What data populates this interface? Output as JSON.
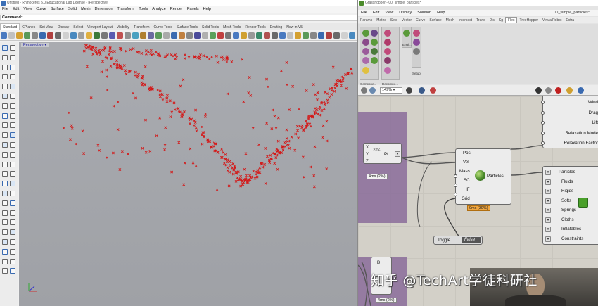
{
  "rhino": {
    "title": "Untitled - Rhinoceros 5.0 Educational Lab License - [Perspective]",
    "menu": [
      "File",
      "Edit",
      "View",
      "Curve",
      "Surface",
      "Solid",
      "Mesh",
      "Dimension",
      "Transform",
      "Tools",
      "Analyze",
      "Render",
      "Panels",
      "Help"
    ],
    "command_label": "Command:",
    "tabs": [
      "Standard",
      "CPlanes",
      "Set View",
      "Display",
      "Select",
      "Viewport Layout",
      "Visibility",
      "Transform",
      "Curve Tools",
      "Surface Tools",
      "Solid Tools",
      "Mesh Tools",
      "Render Tools",
      "Drafting",
      "New in V5"
    ],
    "active_tab": "Standard",
    "viewport_label": "Perspective"
  },
  "gh": {
    "title": "Grasshopper - 00_simple_particles*",
    "document": "00_simple_particles*",
    "menu": [
      "File",
      "Edit",
      "View",
      "Display",
      "Solution",
      "Help"
    ],
    "tabs": [
      "Params",
      "Maths",
      "Sets",
      "Vector",
      "Curve",
      "Surface",
      "Mesh",
      "Intersect",
      "Trans",
      "Dis",
      "Kg",
      "Flex",
      "TreeHopper",
      "VirtualRobot",
      "Extra"
    ],
    "active_tab": "Flex",
    "ribbon_groups": [
      "Compone...",
      "Decompo...",
      "Engi...",
      "Setup"
    ],
    "zoom": "149%"
  },
  "canvas": {
    "pt_component": {
      "inputs": [
        "X",
        "Y",
        "Z"
      ],
      "name": "Pt",
      "timing": "4ms (2%)"
    },
    "particles_component": {
      "inputs": [
        "Pos",
        "Vel",
        "Mass",
        "SC",
        "IF",
        "Grid"
      ],
      "name": "Particles",
      "timing": "9ms (39%)"
    },
    "toggle": {
      "label": "Toggle",
      "value": "False"
    },
    "flex_params_top": [
      "Wind",
      "Drag",
      "Lift",
      "Relaxation Mode",
      "Relaxation Factor"
    ],
    "flex_outputs": [
      "Particles",
      "Fluids",
      "Rigids",
      "Softs",
      "Springs",
      "Cloths",
      "Inflatables",
      "Constraints"
    ],
    "bottom_component": {
      "input": "B",
      "timing": "4ms (2%)"
    }
  },
  "overlay": {
    "watermark": "知乎 @TechArt学徒科研社"
  },
  "colors": {
    "particle": "#d41818",
    "group": "#8a6c9a",
    "timing_badge": "#f0a640"
  }
}
